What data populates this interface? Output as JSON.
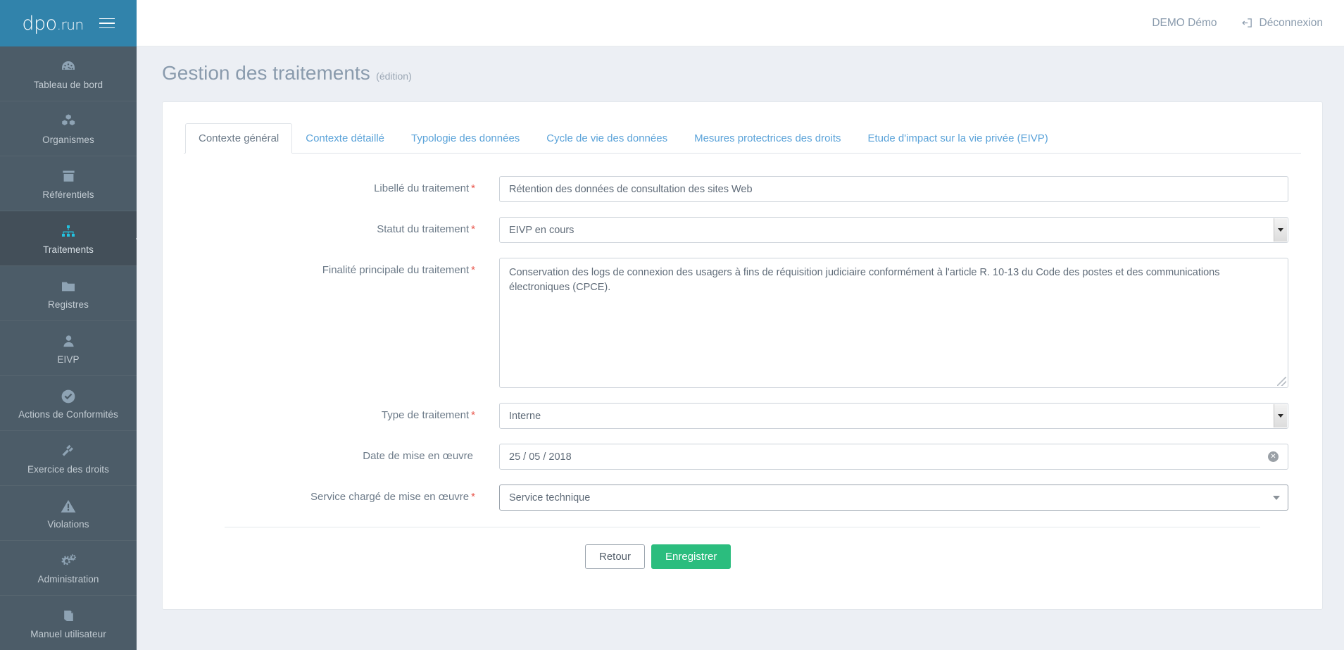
{
  "brand": {
    "name": "dpo",
    "suffix": ".run",
    "menu_icon": "hamburger-icon"
  },
  "sidebar": {
    "items": [
      {
        "label": "Tableau de bord",
        "icon": "dashboard-gauge-icon",
        "active": false
      },
      {
        "label": "Organismes",
        "icon": "boxes-icon",
        "active": false
      },
      {
        "label": "Référentiels",
        "icon": "archive-box-icon",
        "active": false
      },
      {
        "label": "Traitements",
        "icon": "sitemap-icon",
        "active": true
      },
      {
        "label": "Registres",
        "icon": "folder-icon",
        "active": false
      },
      {
        "label": "EIVP",
        "icon": "user-icon",
        "active": false
      },
      {
        "label": "Actions de Conformités",
        "icon": "check-circle-icon",
        "active": false
      },
      {
        "label": "Exercice des droits",
        "icon": "gavel-icon",
        "active": false
      },
      {
        "label": "Violations",
        "icon": "warning-triangle-icon",
        "active": false
      },
      {
        "label": "Administration",
        "icon": "gears-icon",
        "active": false
      },
      {
        "label": "Manuel utilisateur",
        "icon": "book-icon",
        "active": false
      }
    ]
  },
  "topbar": {
    "user": "DEMO Démo",
    "logout_label": "Déconnexion",
    "logout_icon": "sign-out-icon"
  },
  "page": {
    "title": "Gestion des traitements",
    "subtitle": "(édition)"
  },
  "tabs": [
    {
      "label": "Contexte général",
      "active": true
    },
    {
      "label": "Contexte détaillé",
      "active": false
    },
    {
      "label": "Typologie des données",
      "active": false
    },
    {
      "label": "Cycle de vie des données",
      "active": false
    },
    {
      "label": "Mesures protectrices des droits",
      "active": false
    },
    {
      "label": "Etude d'impact sur la vie privée (EIVP)",
      "active": false
    }
  ],
  "form": {
    "libelle": {
      "label": "Libellé du traitement",
      "required": "*",
      "value": "Rétention des données de consultation des sites Web"
    },
    "statut": {
      "label": "Statut du traitement",
      "required": "*",
      "value": "EIVP en cours"
    },
    "finalite": {
      "label": "Finalité principale du traitement",
      "required": "*",
      "value": "Conservation des logs de connexion des usagers à fins de réquisition judiciaire conformément à l'article R. 10-13 du Code des postes et des communications électroniques (CPCE)."
    },
    "type": {
      "label": "Type de traitement",
      "required": "*",
      "value": "Interne"
    },
    "date_mise_en_oeuvre": {
      "label": "Date de mise en œuvre",
      "required": "",
      "value": "25 / 05 / 2018",
      "clear_icon": "clear-circle-x-icon",
      "clear_glyph": "✕"
    },
    "service": {
      "label": "Service chargé de mise en œuvre",
      "required": "*",
      "value": "Service technique"
    }
  },
  "actions": {
    "back_label": "Retour",
    "save_label": "Enregistrer"
  },
  "colors": {
    "brand_blue": "#3183ab",
    "sidebar": "#4c5c68",
    "sidebar_active": "#434f59",
    "accent_cyan": "#22c2e0",
    "link_blue": "#5ba3d9",
    "required_red": "#e8544a",
    "success_green": "#2bbd7e"
  }
}
